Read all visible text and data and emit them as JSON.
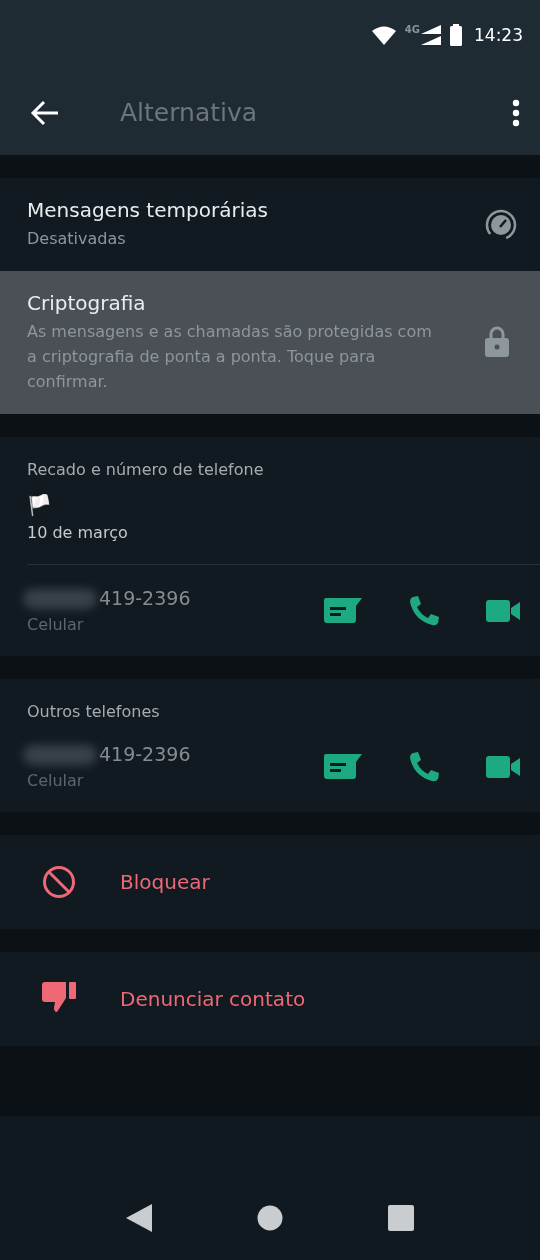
{
  "status_bar": {
    "network": "4G",
    "time": "14:23"
  },
  "header": {
    "title": "Alternativa"
  },
  "settings": [
    {
      "kind": "timer",
      "title": "Mensagens temporárias",
      "subtitle": "Desativadas",
      "selected": false
    },
    {
      "kind": "lock",
      "title": "Criptografia",
      "subtitle": "As mensagens e as chamadas são protegidas com a criptografia de ponta a ponta. Toque para confirmar.",
      "selected": true
    }
  ],
  "about": {
    "heading": "Recado e número de telefone",
    "status_emoji": "🏳️",
    "date": "10 de março",
    "phone": {
      "number": "419-2396",
      "label": "Celular"
    }
  },
  "other_phones": {
    "heading": "Outros telefones",
    "phones": [
      {
        "number": "419-2396",
        "label": "Celular"
      }
    ]
  },
  "actions": [
    {
      "kind": "block",
      "label": "Bloquear"
    },
    {
      "kind": "report",
      "label": "Denunciar contato"
    }
  ]
}
